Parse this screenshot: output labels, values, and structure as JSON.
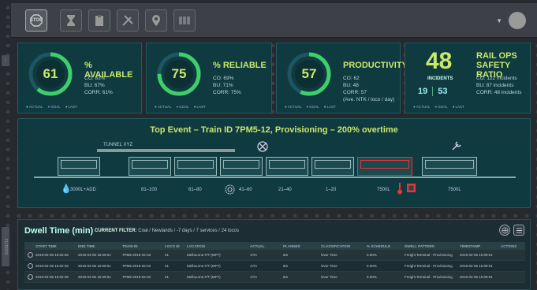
{
  "toolbar": {
    "stop_label": "STOP",
    "buttons": [
      "hourglass-icon",
      "clipboard-icon",
      "tools-icon",
      "location-pin-icon",
      "barcode-icon"
    ]
  },
  "kpis": [
    {
      "value": "61",
      "title": "% AVAILABLE",
      "lines": [
        "CO: 83%",
        "BU: 67%",
        "CORR: 61%"
      ],
      "fraction": 0.61
    },
    {
      "value": "75",
      "title": "% RELIABLE",
      "lines": [
        "CO: 69%",
        "BU: 71%",
        "CORR: 75%"
      ],
      "fraction": 0.75
    },
    {
      "value": "57",
      "title": "PRODUCTIVITY",
      "lines": [
        "CO: 62",
        "BU: 48",
        "CORR: 57",
        "(Ave. NTK / loco / day)"
      ],
      "fraction": 0.57
    }
  ],
  "legend": {
    "actual": "ACTUAL",
    "goal": "GOAL",
    "last": "LAST"
  },
  "safety": {
    "value": "48",
    "title_1": "RAIL OPS",
    "title_2": "SAFETY RATIO",
    "incidents_label": "INCIDENTS",
    "inc_a": "19",
    "inc_b": "53",
    "lines": [
      "CO: 122 incidents",
      "BU: 87 incidents",
      "CORR: 48 incidents"
    ]
  },
  "event": {
    "title": "Top Event – Train ID 7PM5-12, Provisioning – 200% overtime",
    "tunnel": "TUNNEL XYZ",
    "segments": [
      "3000L+ADD",
      "81–100",
      "61–80",
      "41–60",
      "21–40",
      "1–20",
      "7500L",
      "7500L"
    ]
  },
  "dwell": {
    "title": "Dwell Time (min)",
    "filter_label": "CURRENT FILTER:",
    "filter_value": "Coal / Newlands / -7 days / 7 services / 24 locos",
    "columns": [
      "",
      "START TIME",
      "END TIME",
      "TRAIN ID",
      "LOCO ID",
      "LOCATION",
      "ACTUAL",
      "PLANNED",
      "CLASSIFICATION",
      "% SCHEDULE",
      "DWELL PATTERN",
      "TIMESTAMP",
      "ACTIONS"
    ],
    "rows": [
      [
        "",
        "2019-02-05 15:02:39",
        "2019-02-05 15:09:01",
        "7PM5-2019-02-02",
        "21",
        "Melbourne F/T (MFT)",
        "17m",
        "6m",
        "Over Time",
        "0.00%",
        "Freight Terminal - Provisioning",
        "2019-02-05 15:09:01",
        ""
      ],
      [
        "",
        "2019-02-05 15:02:39",
        "2019-02-05 15:09:01",
        "7PM5-2019-02-02",
        "21",
        "Melbourne F/T (MFT)",
        "17m",
        "6m",
        "Over Time",
        "0.00%",
        "Freight Terminal - Provisioning",
        "2019-02-05 15:09:01",
        ""
      ],
      [
        "",
        "2019-02-05 15:02:39",
        "2019-02-05 15:09:01",
        "7PM5-2019-02-02",
        "21",
        "Melbourne F/T (MFT)",
        "17m",
        "6m",
        "Over Time",
        "0.00%",
        "Freight Terminal - Provisioning",
        "2019-02-05 15:09:01",
        ""
      ]
    ]
  },
  "side_tab_bottom": "FILTERS",
  "colors": {
    "accent": "#c8e86c",
    "ring": "#3ecf6a",
    "panel": "#0f3a40",
    "alert": "#e33333"
  }
}
